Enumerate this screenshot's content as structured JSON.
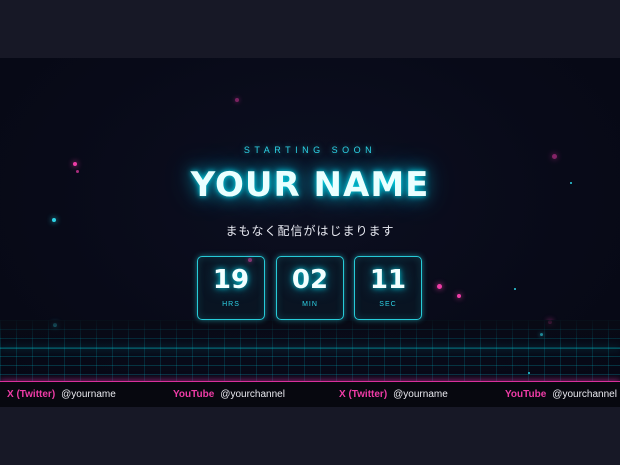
{
  "overlay": {
    "kicker": "STARTING SOON",
    "title": "YOUR NAME",
    "subtitle": "まもなく配信がはじまります"
  },
  "countdown": [
    {
      "value": "19",
      "unit": "HRS"
    },
    {
      "value": "02",
      "unit": "MIN"
    },
    {
      "value": "11",
      "unit": "SEC"
    }
  ],
  "ticker": [
    {
      "label": "X (Twitter)",
      "handle": "@yourname"
    },
    {
      "label": "YouTube",
      "handle": "@yourchannel"
    },
    {
      "label": "X (Twitter)",
      "handle": "@yourname"
    },
    {
      "label": "YouTube",
      "handle": "@yourchannel"
    }
  ],
  "colors": {
    "accent_cyan": "#2ed3e6",
    "accent_magenta": "#ee3ca6",
    "background": "#080a18"
  }
}
